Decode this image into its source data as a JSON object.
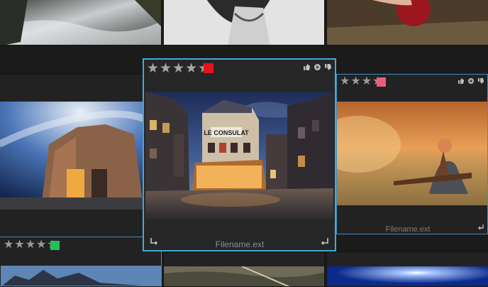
{
  "grid": {
    "rating_symbol": "★",
    "selected": {
      "stars": 5,
      "label_color": "#e4141b",
      "filename": "Filename.ext",
      "sign_text": "LE CONSULAT"
    },
    "right": {
      "stars": 4,
      "label_color": "#ed5d73",
      "filename": "Filename.ext"
    },
    "bottom_left": {
      "stars": 5,
      "label_color": "#23c058"
    }
  },
  "colors": {
    "selection": "#44a8d8",
    "background": "#1b1b1c"
  }
}
